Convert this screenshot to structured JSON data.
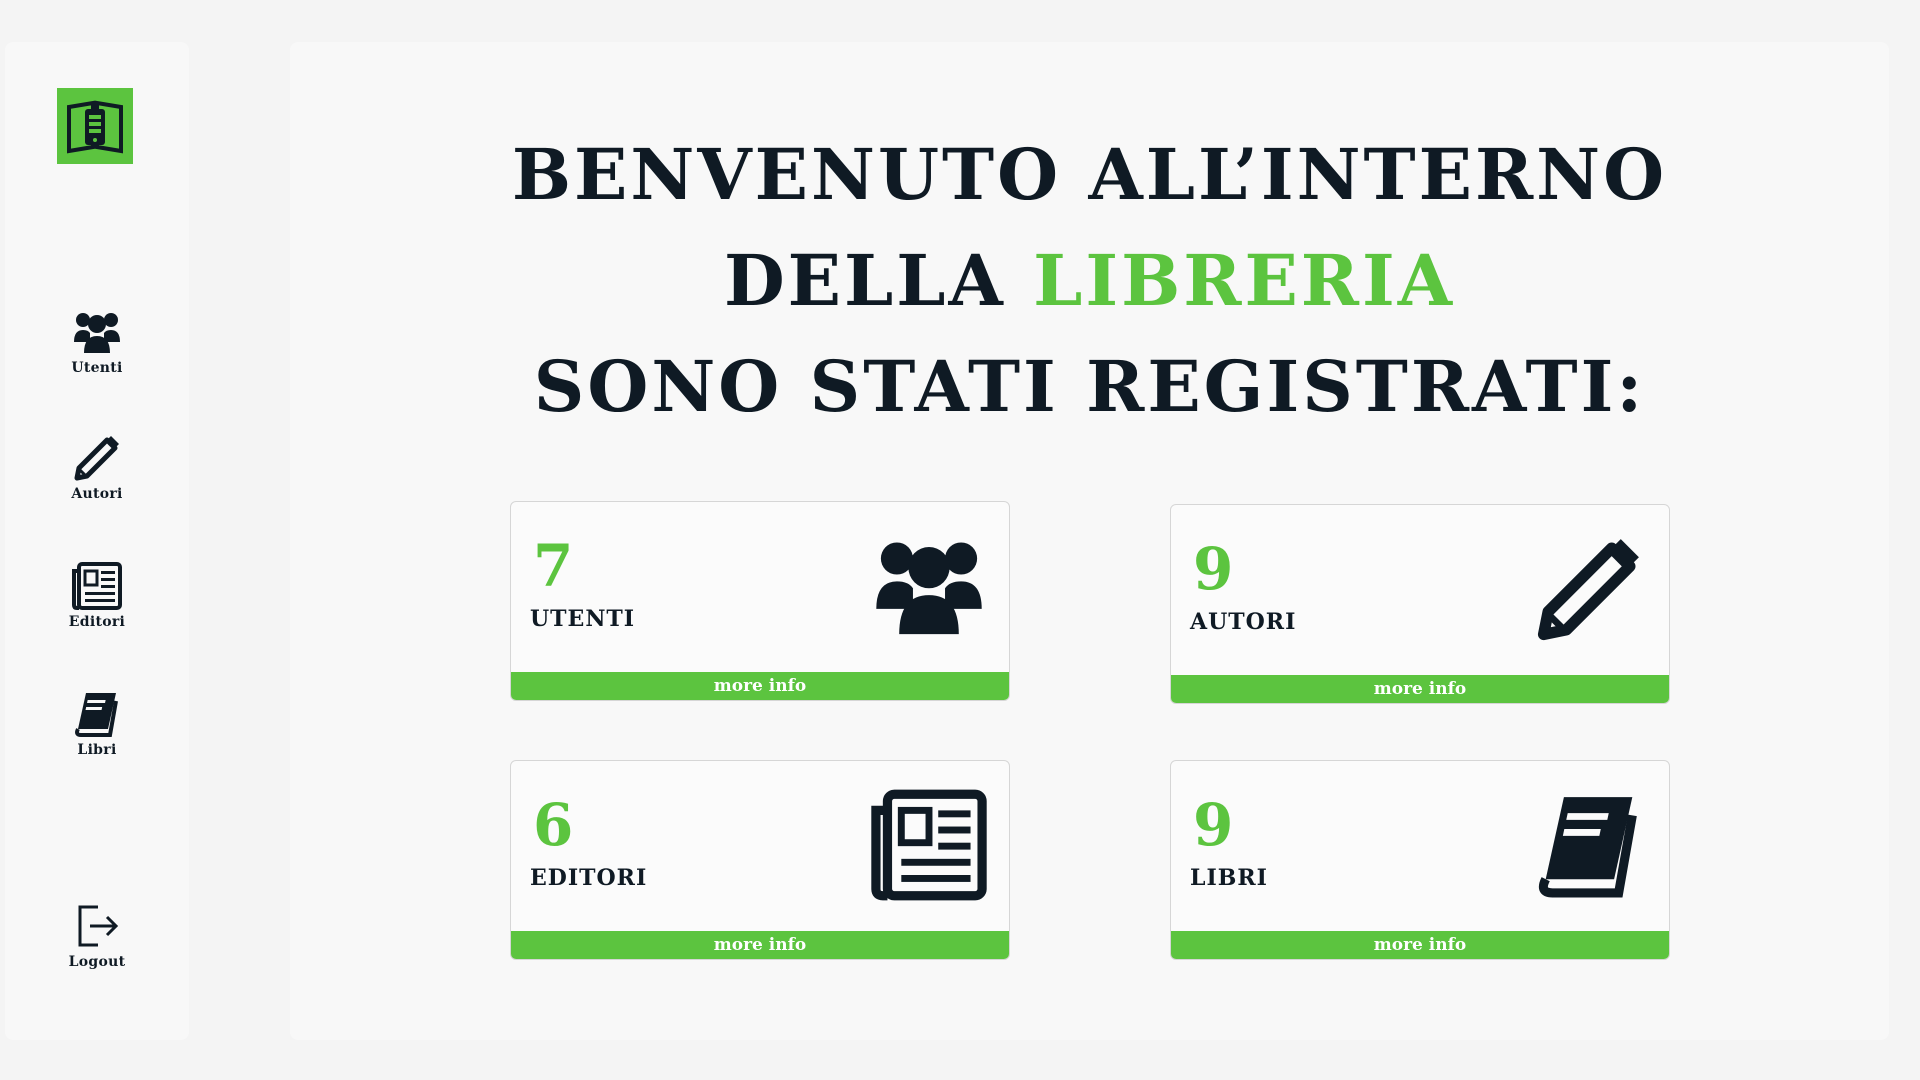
{
  "sidebar": {
    "logo_icon": "book-phone-icon",
    "items": [
      {
        "label": "Utenti",
        "icon": "users-icon"
      },
      {
        "label": "Autori",
        "icon": "pencil-icon"
      },
      {
        "label": "Editori",
        "icon": "newspaper-icon"
      },
      {
        "label": "Libri",
        "icon": "book-icon"
      }
    ],
    "logout": {
      "label": "Logout",
      "icon": "logout-icon"
    }
  },
  "main": {
    "headline": {
      "line1": "BENVENUTO ALL’INTERNO",
      "line2_prefix": "DELLA ",
      "line2_accent": "LIBRERIA",
      "line3": "SONO STATI REGISTRATI:"
    },
    "cards": [
      {
        "count": "7",
        "label": "UTENTI",
        "icon": "users-icon",
        "more": "more info"
      },
      {
        "count": "9",
        "label": "AUTORI",
        "icon": "pencil-icon",
        "more": "more info"
      },
      {
        "count": "6",
        "label": "EDITORI",
        "icon": "newspaper-icon",
        "more": "more info"
      },
      {
        "count": "9",
        "label": "LIBRI",
        "icon": "book-icon",
        "more": "more info"
      }
    ]
  },
  "colors": {
    "accent": "#5cc43f",
    "text": "#0f1a24",
    "panel": "#f8f8f8"
  }
}
